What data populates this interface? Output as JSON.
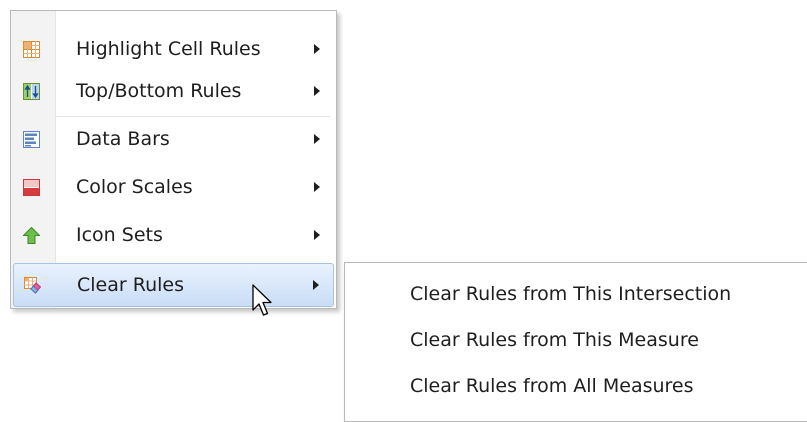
{
  "menu": {
    "items": [
      {
        "label": "Highlight Cell Rules",
        "icon": "highlight-cell-rules-icon"
      },
      {
        "label": "Top/Bottom Rules",
        "icon": "top-bottom-rules-icon"
      },
      {
        "label": "Data Bars",
        "icon": "data-bars-icon"
      },
      {
        "label": "Color Scales",
        "icon": "color-scales-icon"
      },
      {
        "label": "Icon Sets",
        "icon": "icon-sets-icon"
      },
      {
        "label": "Clear Rules",
        "icon": "clear-rules-icon"
      }
    ]
  },
  "submenu": {
    "items": [
      {
        "label": "Clear Rules from This Intersection"
      },
      {
        "label": "Clear Rules from This Measure"
      },
      {
        "label": "Clear Rules from All Measures"
      }
    ]
  }
}
